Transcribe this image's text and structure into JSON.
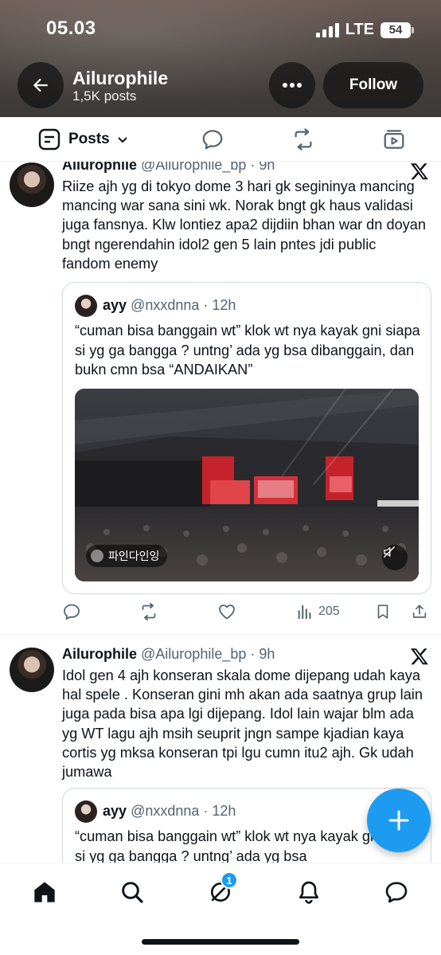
{
  "status_bar": {
    "time": "05.03",
    "network": "LTE",
    "battery": "54"
  },
  "profile": {
    "name": "Ailurophile",
    "posts_count": "1,5K posts",
    "follow_label": "Follow"
  },
  "tabs": {
    "posts_label": "Posts"
  },
  "posts": [
    {
      "header_name": "Ailurophile",
      "header_meta": "@Ailurophile_bp · 9h",
      "text": "Riize ajh yg di tokyo dome 3 hari gk segininya mancing mancing war sana sini wk. Norak bngt gk haus validasi juga fansnya. Klw lontiez apa2 dijdiin bhan war dn doyan bngt ngerendahin idol2 gen 5 lain pntes jdi public fandom enemy",
      "quote": {
        "name": "ayy",
        "meta": "@nxxdnna · 12h",
        "text": "“cuman bisa banggain wt” klok wt nya kayak gni siapa si yg ga bangga ? untng’ ada yg bsa dibanggain, dan bukn cmn bsa “ANDAIKAN”",
        "media_tag": "파인다인잉"
      },
      "views": "205"
    },
    {
      "header_name": "Ailurophile",
      "header_meta": "@Ailurophile_bp · 9h",
      "text": "Idol gen 4 ajh konseran skala dome dijepang udah kaya hal spele . Konseran gini mh akan ada saatnya grup lain juga pada bisa apa lgi dijepang. Idol lain wajar blm ada yg WT lagu ajh msih seuprit jngn sampe kjadian kaya cortis yg mksa konseran tpi lgu cumn itu2 ajh. Gk udah jumawa",
      "quote": {
        "name": "ayy",
        "meta": "@nxxdnna · 12h",
        "text": "“cuman bisa banggain wt” klok wt nya kayak gni siapa si yg ga bangga ? untng’ ada yg bsa"
      }
    }
  ],
  "bottom_nav": {
    "messages_badge": "1"
  },
  "colors": {
    "accent": "#1d9bf0",
    "text": "#0f1419",
    "muted": "#536471"
  }
}
